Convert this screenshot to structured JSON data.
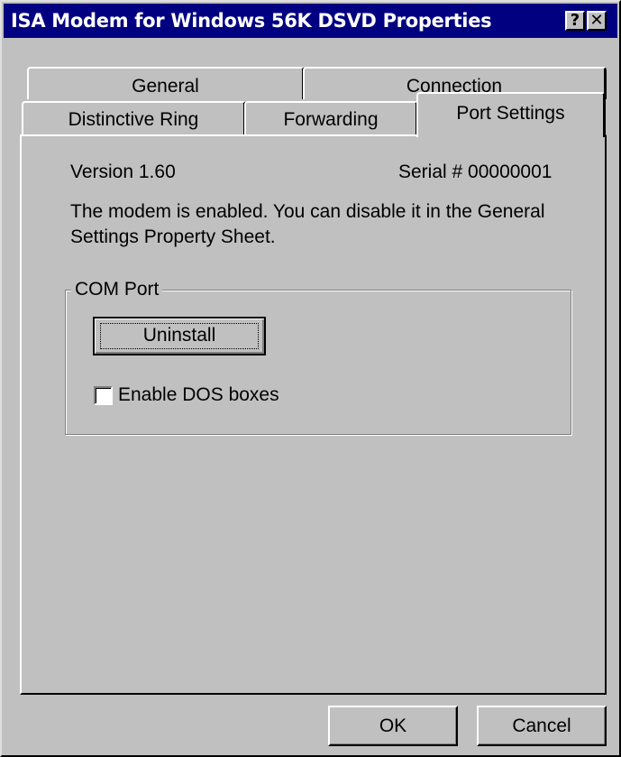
{
  "window": {
    "title": "ISA Modem for Windows 56K DSVD Properties"
  },
  "title_buttons": {
    "help": "?",
    "close": "✕"
  },
  "tabs": {
    "back_row": [
      "General",
      "Connection"
    ],
    "front_row": [
      "Distinctive Ring",
      "Forwarding",
      "Port Settings"
    ],
    "selected": "Port Settings"
  },
  "info": {
    "version": "Version 1.60",
    "serial": "Serial # 00000001",
    "message": "The modem is enabled. You can disable it in the General Settings Property Sheet."
  },
  "com_port": {
    "label": "COM Port",
    "uninstall_label": "Uninstall",
    "dos_boxes_label": "Enable DOS boxes",
    "dos_boxes_checked": false
  },
  "footer": {
    "ok_label": "OK",
    "cancel_label": "Cancel"
  }
}
